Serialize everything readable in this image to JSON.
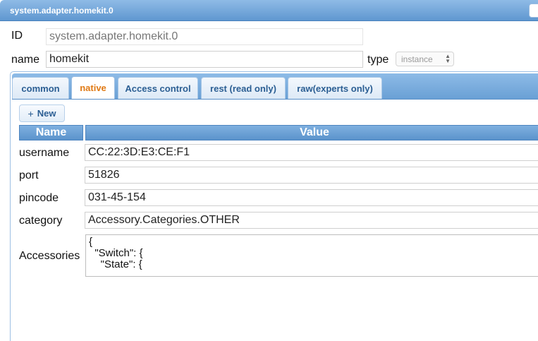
{
  "window": {
    "title": "system.adapter.homekit.0"
  },
  "form": {
    "id_label": "ID",
    "id_value": "system.adapter.homekit.0",
    "name_label": "name",
    "name_value": "homekit",
    "type_label": "type",
    "type_value": "instance"
  },
  "tabs": [
    {
      "label": "common",
      "active": false
    },
    {
      "label": "native",
      "active": true
    },
    {
      "label": "Access control",
      "active": false
    },
    {
      "label": "rest (read only)",
      "active": false
    },
    {
      "label": "raw(experts only)",
      "active": false
    }
  ],
  "native": {
    "new_button_label": "New",
    "columns": {
      "name": "Name",
      "value": "Value"
    },
    "rows": [
      {
        "name": "username",
        "value": "CC:22:3D:E3:CE:F1"
      },
      {
        "name": "port",
        "value": "51826"
      },
      {
        "name": "pincode",
        "value": "031-45-154"
      },
      {
        "name": "category",
        "value": "Accessory.Categories.OTHER"
      }
    ],
    "accessories": {
      "name": "Accessories",
      "value": "{\n  \"Switch\": {\n    \"State\": {"
    }
  },
  "colors": {
    "header_blue": "#6aa0d5",
    "tab_text": "#2b5e93",
    "active_tab_text": "#e07a15"
  }
}
